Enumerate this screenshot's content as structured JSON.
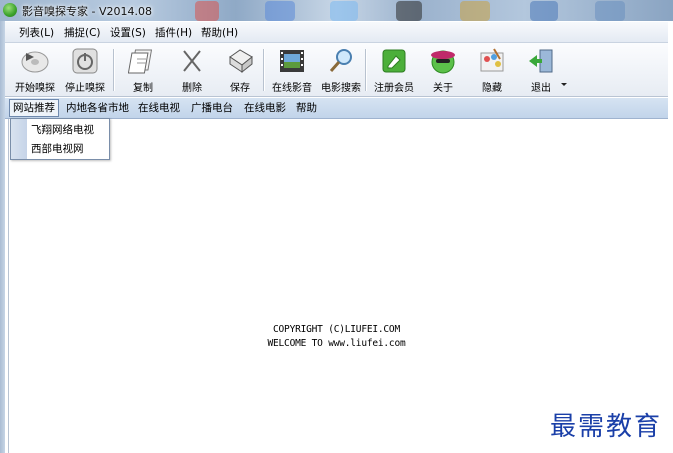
{
  "window": {
    "title": "影音嗅探专家 - V2014.08"
  },
  "menu": [
    "列表(L)",
    "捕捉(C)",
    "设置(S)",
    "插件(H)",
    "帮助(H)"
  ],
  "toolbar": {
    "start_sniff": "开始嗅探",
    "stop_sniff": "停止嗅探",
    "copy": "复制",
    "delete": "删除",
    "save": "保存",
    "online_video": "在线影音",
    "movie_search": "电影搜索",
    "register_member": "注册会员",
    "about": "关于",
    "hide": "隐藏",
    "exit": "退出"
  },
  "tabs": [
    "网站推荐",
    "内地各省市地",
    "在线电视",
    "广播电台",
    "在线电影",
    "帮助"
  ],
  "dropdown": [
    "飞翔网络电视",
    "西部电视网"
  ],
  "content": {
    "line1": "COPYRIGHT (C)LIUFEI.COM",
    "line2": "WELCOME TO www.liufei.com"
  },
  "watermark": "最需教育",
  "colors": {
    "accent": "#1a3fa8",
    "tab_bg": "#c8d8ec"
  }
}
